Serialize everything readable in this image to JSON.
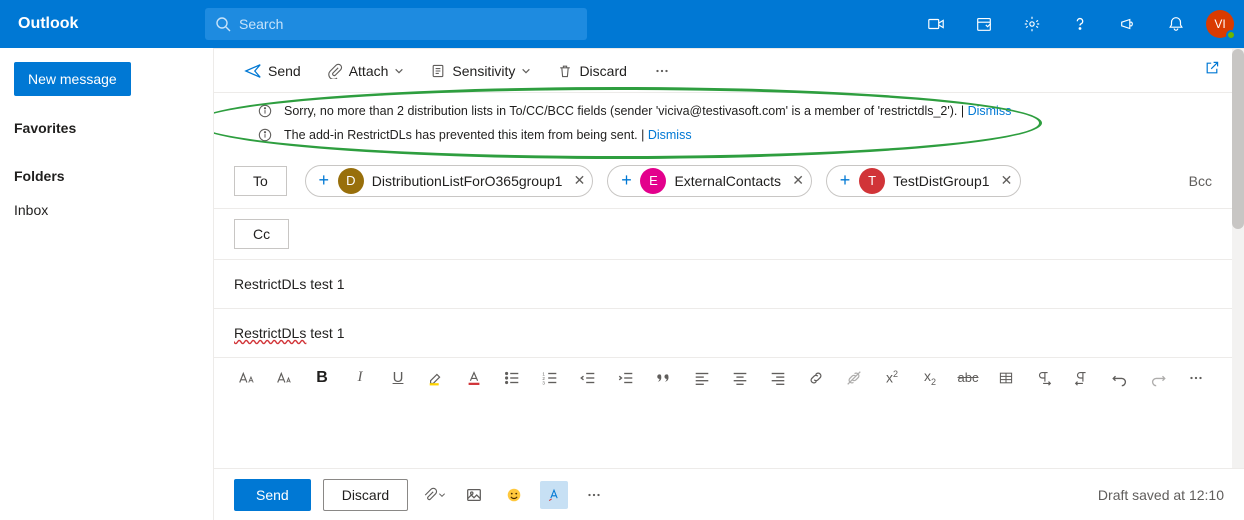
{
  "header": {
    "brand": "Outlook",
    "search_placeholder": "Search",
    "avatar_initials": "VI"
  },
  "folder_pane": {
    "new_message": "New message",
    "favorites_header": "Favorites",
    "folders_header": "Folders",
    "inbox": "Inbox"
  },
  "cmdbar": {
    "send": "Send",
    "attach": "Attach",
    "sensitivity": "Sensitivity",
    "discard": "Discard"
  },
  "infobars": {
    "msg1": "Sorry, no more than 2 distribution lists in To/CC/BCC fields (sender 'viciva@testivasoft.com' is a member of 'restrictdls_2'). | ",
    "msg2": "The add-in RestrictDLs has prevented this item from being sent. | ",
    "dismiss": "Dismiss"
  },
  "fields": {
    "to_label": "To",
    "cc_label": "Cc",
    "bcc_label": "Bcc",
    "recipients": [
      {
        "initial": "D",
        "color": "#986f0b",
        "name": "DistributionListForO365group1"
      },
      {
        "initial": "E",
        "color": "#e3008c",
        "name": "ExternalContacts"
      },
      {
        "initial": "T",
        "color": "#d13438",
        "name": "TestDistGroup1"
      }
    ]
  },
  "subject": "RestrictDLs test 1",
  "body_misspelled": "RestrictDLs",
  "body_tail": " test 1",
  "sendbar": {
    "send": "Send",
    "discard": "Discard",
    "draft_status": "Draft saved at 12:10"
  }
}
